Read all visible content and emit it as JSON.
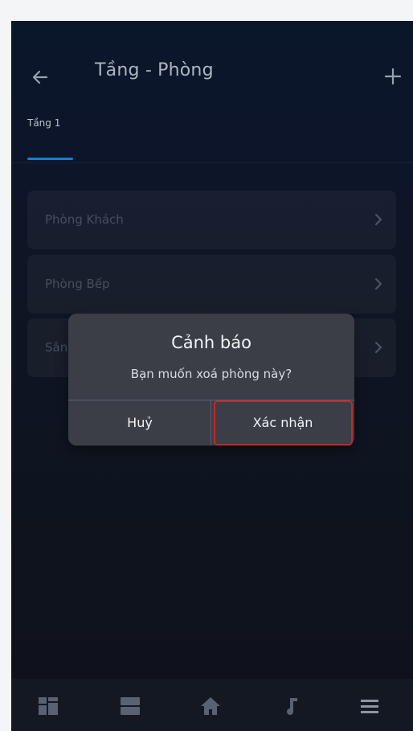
{
  "header": {
    "title": "Tầng - Phòng",
    "back_icon": "arrow-left-icon",
    "add_icon": "plus-icon"
  },
  "tabs": [
    {
      "label": "Tầng 1",
      "active": true
    }
  ],
  "rooms": [
    {
      "name": "Phòng Khách"
    },
    {
      "name": "Phòng Bếp"
    },
    {
      "name": "Sân"
    }
  ],
  "dialog": {
    "title": "Cảnh báo",
    "message": "Bạn muốn xoá phòng này?",
    "cancel_label": "Huỷ",
    "confirm_label": "Xác nhận"
  },
  "bottom_nav": [
    {
      "icon": "dashboard-icon"
    },
    {
      "icon": "devices-icon"
    },
    {
      "icon": "home-icon"
    },
    {
      "icon": "music-icon"
    },
    {
      "icon": "menu-icon"
    }
  ],
  "colors": {
    "accent": "#1f8fe6",
    "dialog_bg": "#3b3e47",
    "highlight": "#c02a2a"
  }
}
